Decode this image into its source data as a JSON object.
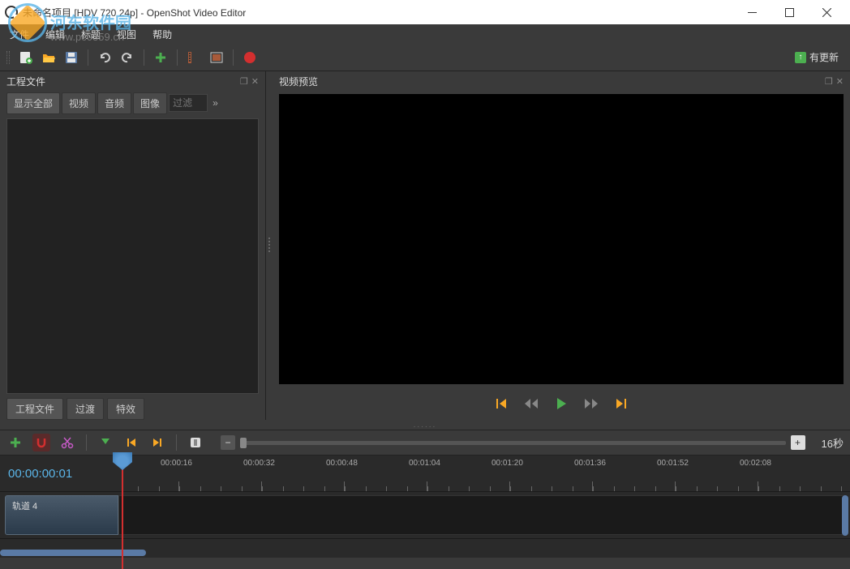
{
  "title": "未命名项目 [HDV 720 24p] - OpenShot Video Editor",
  "watermark": {
    "text": "河东软件园",
    "url": "www.pc0359.cn"
  },
  "menu": {
    "file": "文件",
    "edit": "编辑",
    "title": "标题",
    "view": "视图",
    "help": "帮助"
  },
  "toolbar": {
    "update": "有更新"
  },
  "panels": {
    "project_files": "工程文件",
    "video_preview": "视频预览"
  },
  "file_tabs": {
    "show_all": "显示全部",
    "video": "视频",
    "audio": "音频",
    "image": "图像",
    "filter_placeholder": "过滤"
  },
  "bottom_tabs": {
    "project_files": "工程文件",
    "transitions": "过渡",
    "effects": "特效"
  },
  "timeline": {
    "zoom_label": "16秒",
    "timecode": "00:00:00:01",
    "ruler_labels": [
      "00:00:16",
      "00:00:32",
      "00:00:48",
      "00:01:04",
      "00:01:20",
      "00:01:36",
      "00:01:52",
      "00:02:08"
    ],
    "track_name": "轨道 4"
  }
}
